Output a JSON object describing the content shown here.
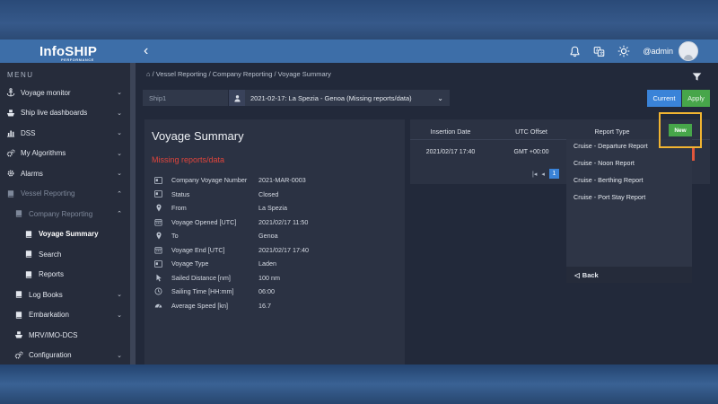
{
  "app": {
    "logo": "InfoSHIP",
    "logo_sub": "PERFORMANCE",
    "user": "@admin"
  },
  "sidebar": {
    "menu_title": "MENU",
    "items": [
      {
        "label": "Voyage monitor",
        "icon": "anchor-icon"
      },
      {
        "label": "Ship live dashboards",
        "icon": "ship-icon"
      },
      {
        "label": "DSS",
        "icon": "chart-icon"
      },
      {
        "label": "My Algorithms",
        "icon": "gears-icon"
      },
      {
        "label": "Alarms",
        "icon": "gear-icon"
      },
      {
        "label": "Vessel Reporting",
        "icon": "book-icon"
      },
      {
        "label": "Company Reporting",
        "icon": "book-icon"
      },
      {
        "label": "Voyage Summary",
        "icon": "book-icon"
      },
      {
        "label": "Search",
        "icon": "book-icon"
      },
      {
        "label": "Reports",
        "icon": "book-icon"
      },
      {
        "label": "Log Books",
        "icon": "book-icon"
      },
      {
        "label": "Embarkation",
        "icon": "book-icon"
      },
      {
        "label": "MRV/IMO-DCS",
        "icon": "ship-icon"
      },
      {
        "label": "Configuration",
        "icon": "gears-icon"
      }
    ]
  },
  "breadcrumb": {
    "home": "⌂",
    "path": " / Vessel Reporting / Company Reporting / Voyage Summary"
  },
  "filters": {
    "ship_placeholder": "Ship1",
    "voyage_value": "2021-02-17: La Spezia - Genoa (Missing reports/data)",
    "current_label": "Current",
    "apply_label": "Apply"
  },
  "summary": {
    "title": "Voyage Summary",
    "warning": "Missing reports/data",
    "rows": [
      {
        "label": "Company Voyage Number",
        "value": "2021-MAR-0003",
        "icon": "id-card-icon"
      },
      {
        "label": "Status",
        "value": "Closed",
        "icon": "id-card-icon"
      },
      {
        "label": "From",
        "value": "La Spezia",
        "icon": "map-pin-icon"
      },
      {
        "label": "Voyage Opened [UTC]",
        "value": "2021/02/17 11:50",
        "icon": "calendar-icon"
      },
      {
        "label": "To",
        "value": "Genoa",
        "icon": "map-pin-icon"
      },
      {
        "label": "Voyage End [UTC]",
        "value": "2021/02/17 17:40",
        "icon": "calendar-icon"
      },
      {
        "label": "Voyage Type",
        "value": "Laden",
        "icon": "id-card-icon"
      },
      {
        "label": "Sailed Distance [nm]",
        "value": "100 nm",
        "icon": "cursor-icon"
      },
      {
        "label": "Sailing Time [HH:mm]",
        "value": "06:00",
        "icon": "clock-icon"
      },
      {
        "label": "Average Speed [kn]",
        "value": "16.7",
        "icon": "speedometer-icon"
      }
    ]
  },
  "reports_table": {
    "headers": [
      "Insertion Date",
      "UTC Offset",
      "Report Type"
    ],
    "rows": [
      [
        "2021/02/17 17:40",
        "GMT +00:00",
        ""
      ]
    ],
    "page": "1",
    "new_label": "New"
  },
  "report_menu": {
    "items": [
      "Cruise - Departure Report",
      "Cruise - Noon Report",
      "Cruise - Berthing Report",
      "Cruise - Port Stay Report"
    ],
    "back_label": "Back"
  }
}
